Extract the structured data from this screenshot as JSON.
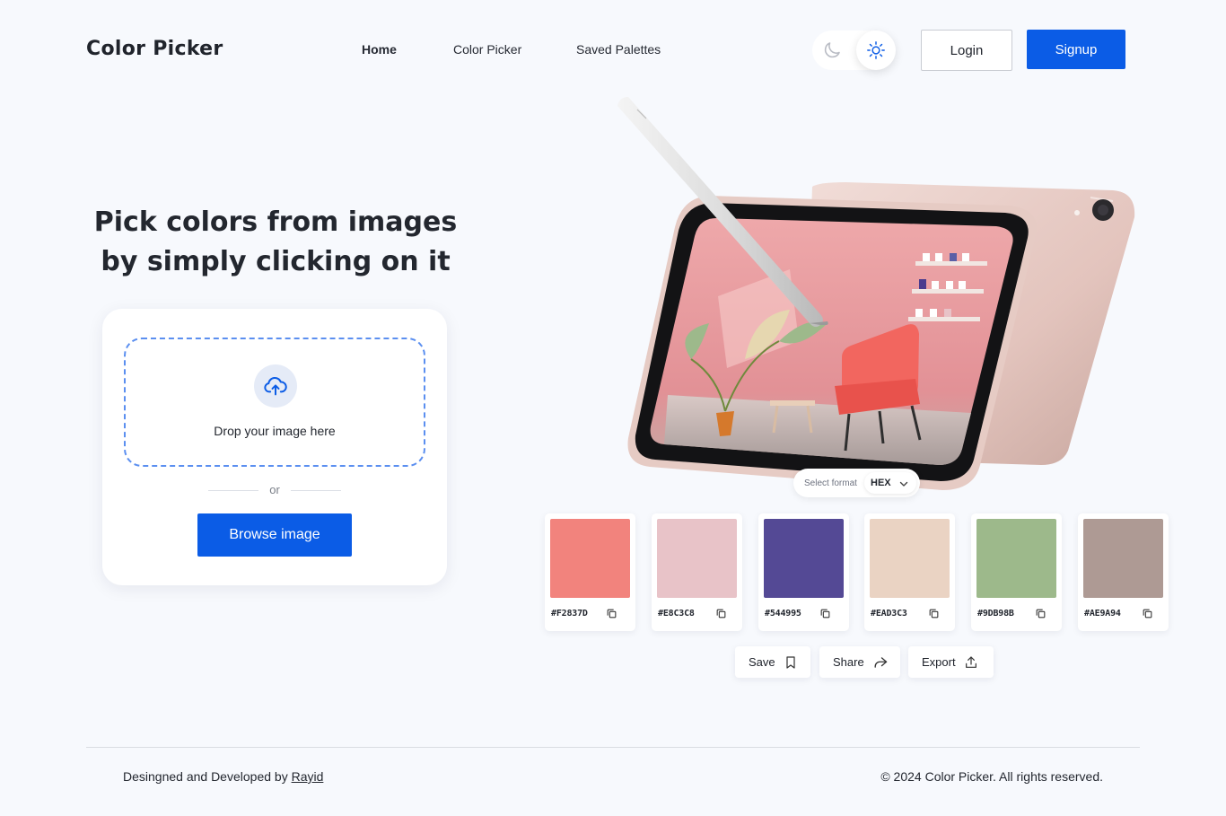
{
  "header": {
    "brand": "Color Picker",
    "nav": [
      {
        "label": "Home",
        "active": true
      },
      {
        "label": "Color Picker",
        "active": false
      },
      {
        "label": "Saved Palettes",
        "active": false
      }
    ],
    "theme": {
      "current": "light",
      "icons": [
        "moon-icon",
        "sun-icon"
      ]
    },
    "login_label": "Login",
    "signup_label": "Signup"
  },
  "hero": {
    "headline_line1": "Pick colors from images",
    "headline_line2": "by simply clicking on it"
  },
  "upload": {
    "drop_text": "Drop your image here",
    "or_text": "or",
    "browse_label": "Browse image",
    "icon": "cloud-upload-icon"
  },
  "format": {
    "label": "Select format",
    "value": "HEX"
  },
  "palette": [
    {
      "code": "#F2837D",
      "color": "#f2837d"
    },
    {
      "code": "#E8C3C8",
      "color": "#e8c3c8"
    },
    {
      "code": "#544995",
      "color": "#544995"
    },
    {
      "code": "#EAD3C3",
      "color": "#ead3c3"
    },
    {
      "code": "#9DB98B",
      "color": "#9db98b"
    },
    {
      "code": "#AE9A94",
      "color": "#ae9a94"
    }
  ],
  "actions": {
    "save": "Save",
    "share": "Share",
    "export": "Export"
  },
  "footer": {
    "credit_prefix": "Desingned and Developed by ",
    "credit_name": "Rayid",
    "copyright": "© 2024 Color Picker. All rights reserved."
  },
  "colors": {
    "accent": "#0b5ce6",
    "background": "#f7f9fd",
    "dropzone_border": "#5b8ff0"
  }
}
